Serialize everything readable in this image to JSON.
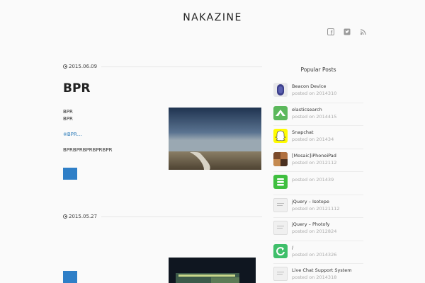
{
  "site": {
    "title": "NAKAZINE"
  },
  "social": [
    "facebook-icon",
    "twitter-icon",
    "rss-icon"
  ],
  "posts": [
    {
      "date": "2015.06.09",
      "title": "BPR",
      "lines": [
        "BPR",
        "BPR"
      ],
      "more": "※BPR…",
      "body": "BPRBPRBPRBPRBPR"
    },
    {
      "date": "2015.05.27"
    }
  ],
  "sidebar": {
    "title": "Popular Posts",
    "items": [
      {
        "title": "Beacon Device",
        "meta": "posted on 2014310"
      },
      {
        "title": "elasticsearch",
        "meta": "posted on 2014415"
      },
      {
        "title": "Snapchat",
        "meta": "posted on 201434"
      },
      {
        "title": "[Mosaic]iPhoneiPad",
        "meta": "posted on 2012112"
      },
      {
        "title": "",
        "meta": "posted on 201439"
      },
      {
        "title": "jQuery – Isotope",
        "meta": "posted on 20121112"
      },
      {
        "title": "jQuery – Photofy",
        "meta": "posted on 2012824"
      },
      {
        "title": "/",
        "meta": "posted on 2014326"
      },
      {
        "title": "Live Chat Support System",
        "meta": "posted on 2014318"
      }
    ]
  },
  "colors": {
    "accent": "#2f7fc7",
    "link": "#2a7ab8"
  }
}
